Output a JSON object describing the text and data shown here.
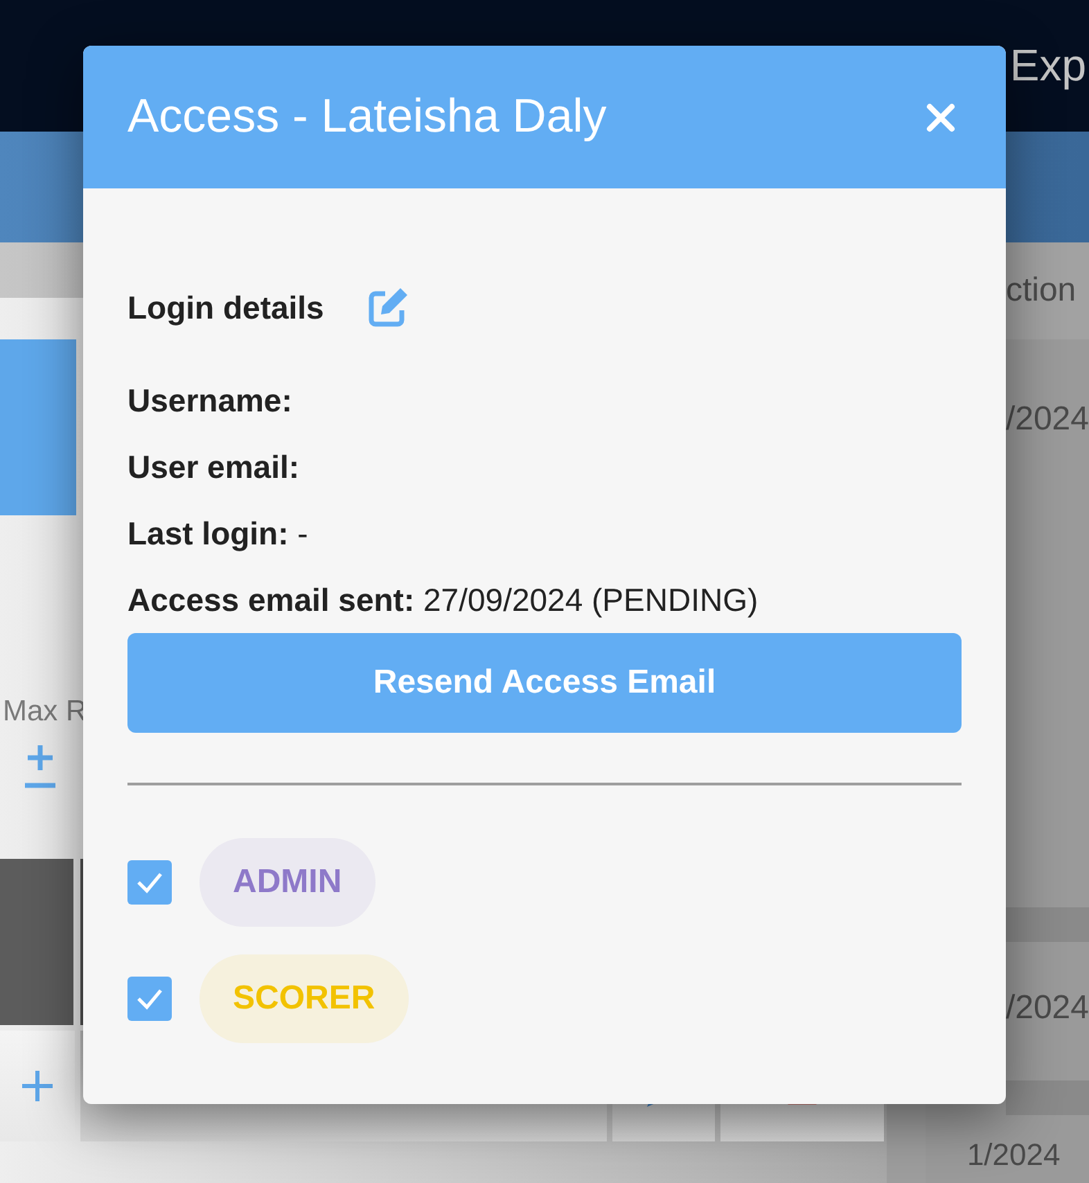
{
  "background": {
    "toolbar_text": "Exp",
    "side_header": "ction",
    "column_header": "Max R",
    "dates": [
      "/2024",
      "/2024",
      "1/2024"
    ]
  },
  "dialog": {
    "title": "Access - Lateisha Daly",
    "section_title": "Login details",
    "username": {
      "label": "Username:"
    },
    "user_email": {
      "label": "User email:"
    },
    "last_login": {
      "label": "Last login:",
      "value": "-"
    },
    "access_email_sent": {
      "label": "Access email sent:",
      "value": "27/09/2024 (PENDING)"
    },
    "button": "Resend Access Email",
    "roles": [
      {
        "label": "ADMIN",
        "checked": true,
        "color": "#8e79c9"
      },
      {
        "label": "SCORER",
        "checked": true,
        "color": "#f2c200"
      }
    ]
  }
}
